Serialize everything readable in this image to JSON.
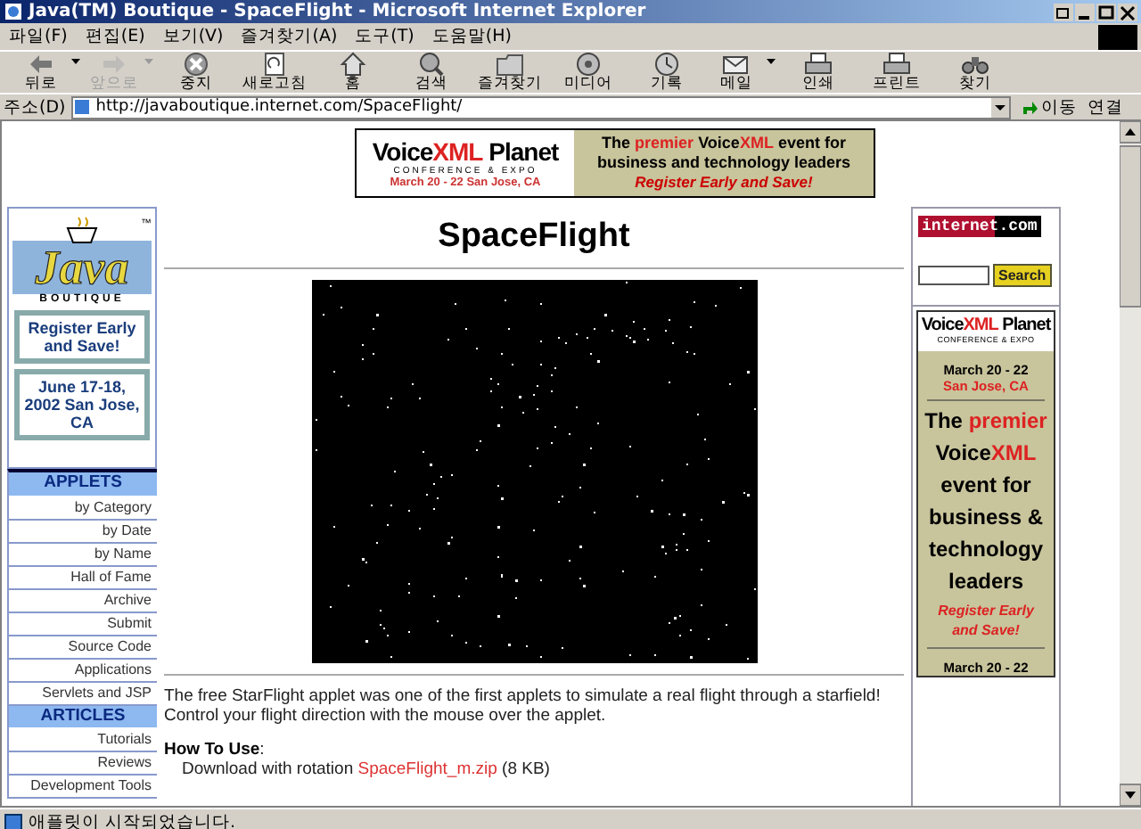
{
  "window": {
    "title": "Java(TM) Boutique - SpaceFlight - Microsoft Internet Explorer"
  },
  "menu_bar": [
    "파일(F)",
    "편집(E)",
    "보기(V)",
    "즐겨찾기(A)",
    "도구(T)",
    "도움말(H)"
  ],
  "toolbar": [
    {
      "label": "뒤로",
      "disabled": false,
      "has_menu": true
    },
    {
      "label": "앞으로",
      "disabled": true,
      "has_menu": true
    },
    {
      "label": "중지",
      "disabled": false,
      "has_menu": false
    },
    {
      "label": "새로고침",
      "disabled": false,
      "has_menu": false
    },
    {
      "label": "홈",
      "disabled": false,
      "has_menu": false
    },
    {
      "label": "검색",
      "disabled": false,
      "has_menu": false
    },
    {
      "label": "즐겨찾기",
      "disabled": false,
      "has_menu": false
    },
    {
      "label": "미디어",
      "disabled": false,
      "has_menu": false
    },
    {
      "label": "기록",
      "disabled": false,
      "has_menu": false
    },
    {
      "label": "메일",
      "disabled": false,
      "has_menu": true
    },
    {
      "label": "인쇄",
      "disabled": false,
      "has_menu": false
    },
    {
      "label": "프린트",
      "disabled": false,
      "has_menu": false
    },
    {
      "label": "찾기",
      "disabled": false,
      "has_menu": false
    }
  ],
  "address_bar": {
    "label": "주소(D)",
    "url": "http://javaboutique.internet.com/SpaceFlight/",
    "go": "이동",
    "links": "연결"
  },
  "page": {
    "top_banner": {
      "logo": "Voice**XML** Planet",
      "subtitle": "CONFERENCE & EXPO",
      "dates": "March 20 - 22 San Jose, CA",
      "tagline": "The **premier** Voice**XML** event for business and technology leaders",
      "cta": "Register Early and Save!"
    },
    "sidebar": {
      "logo": "Java",
      "logo_mark": "™",
      "logo_sub": "BOUTIQUE",
      "promo": "Register Early and Save!",
      "promo_dates": "June 17-18, 2002 San Jose, CA",
      "sections": [
        {
          "title": "APPLETS",
          "items": [
            "by Category",
            "by Date",
            "by Name",
            "Hall of Fame",
            "Archive",
            "Submit",
            "Source Code",
            "Applications",
            "Servlets and JSP"
          ]
        },
        {
          "title": "ARTICLES",
          "items": [
            "Tutorials",
            "Reviews",
            "Development Tools"
          ]
        }
      ]
    },
    "main": {
      "heading": "SpaceFlight",
      "description": "The free StarFlight applet was one of the first applets to simulate a real flight through a starfield! Control your flight direction with the mouse over the applet.",
      "how_to_heading": "How To Use",
      "how_to_colon": ":",
      "download": {
        "before": "Download with rotation ",
        "link": "SpaceFlight_m.zip",
        "after": " (8 KB)"
      }
    },
    "right": {
      "logo": "internet.com",
      "search_button": "Search",
      "banner": {
        "logo": "Voice**XML** Planet",
        "subtitle": "CONFERENCE & EXPO",
        "dates": "March 20 - 22",
        "place": "San Jose, CA",
        "tagline": "The **premier** Voice**XML** event for business & technology leaders",
        "cta": "Register Early and Save!",
        "dates_again": "March 20 - 22"
      }
    }
  },
  "status_bar": {
    "text": "애플릿이 시작되었습니다."
  }
}
